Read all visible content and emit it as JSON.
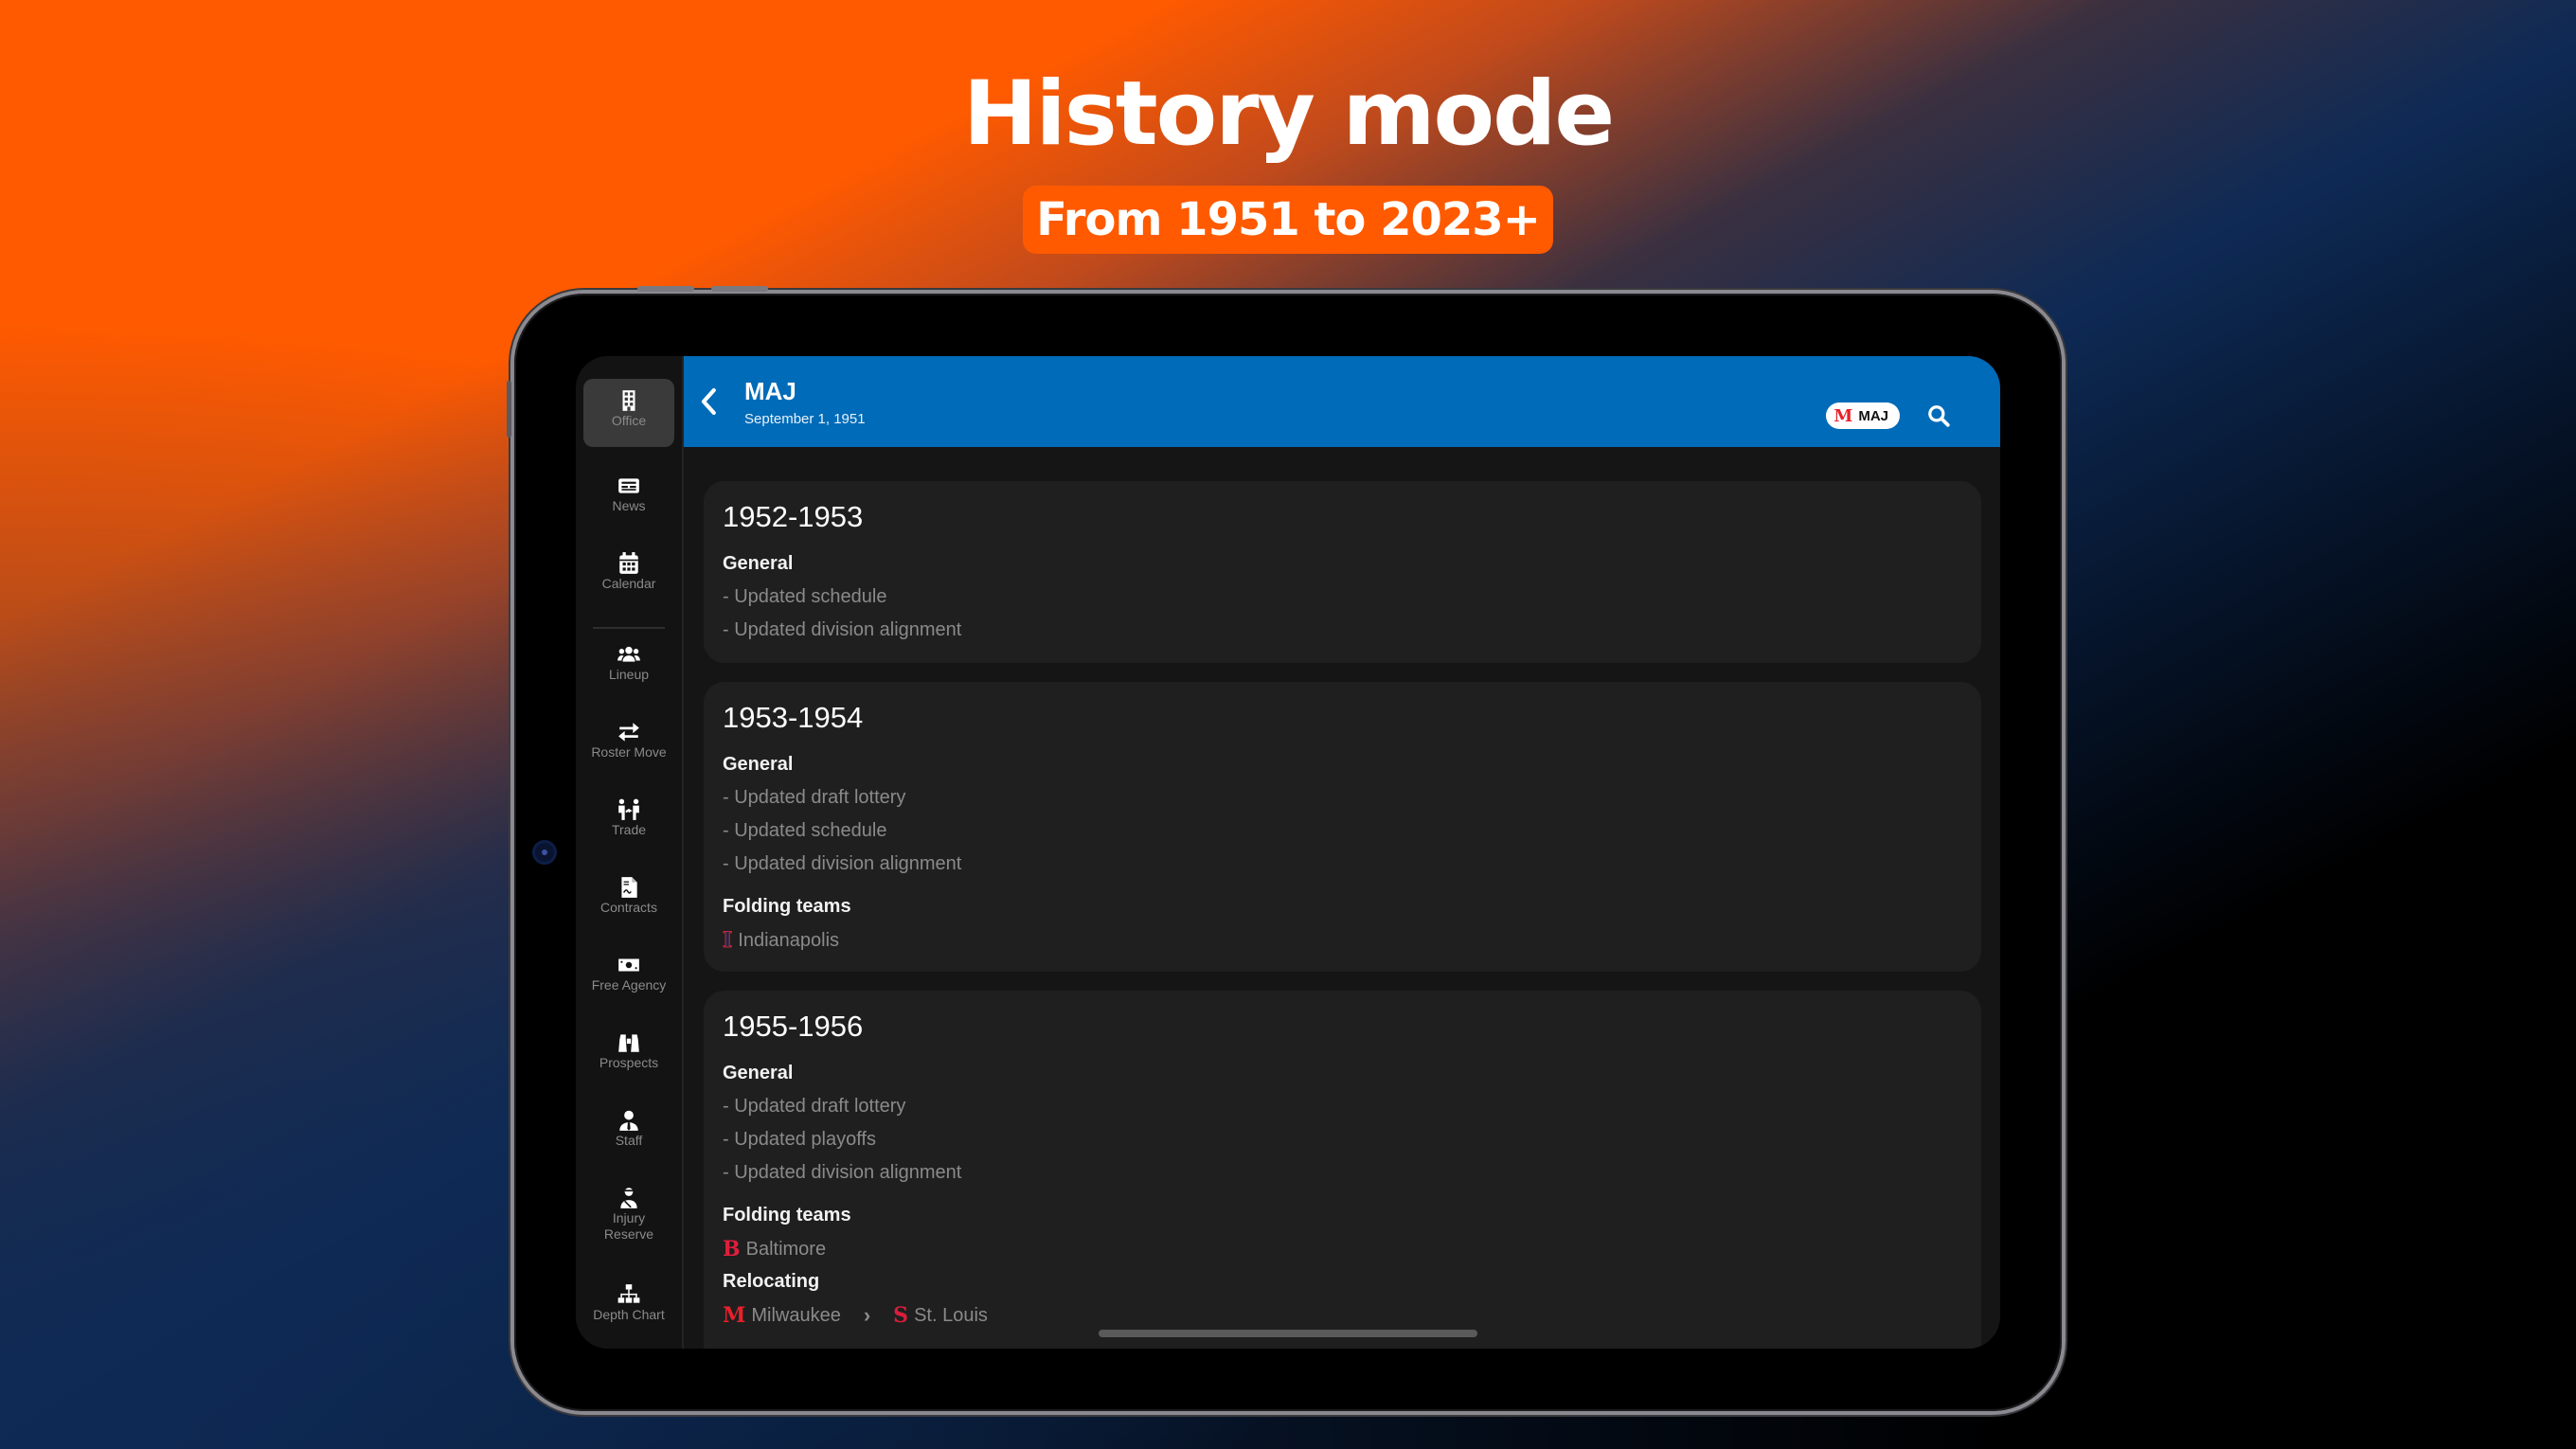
{
  "promo": {
    "headline": "History mode",
    "badge": "From 1951 to 2023+",
    "colors": {
      "orange": "#ff5a00",
      "navy": "#0e2a55"
    }
  },
  "sidebar": {
    "items": [
      {
        "label": "Office",
        "icon": "building-icon",
        "active": true
      },
      {
        "label": "News",
        "icon": "newspaper-icon",
        "active": false
      },
      {
        "label": "Calendar",
        "icon": "calendar-icon",
        "active": false
      },
      {
        "label": "Lineup",
        "icon": "users-icon",
        "active": false
      },
      {
        "label": "Roster Move",
        "icon": "swap-arrows-icon",
        "active": false
      },
      {
        "label": "Trade",
        "icon": "trade-people-icon",
        "active": false
      },
      {
        "label": "Contracts",
        "icon": "contract-document-icon",
        "active": false
      },
      {
        "label": "Free Agency",
        "icon": "money-bill-icon",
        "active": false
      },
      {
        "label": "Prospects",
        "icon": "binoculars-icon",
        "active": false
      },
      {
        "label": "Staff",
        "icon": "staff-person-icon",
        "active": false
      },
      {
        "label": "Injury Reserve",
        "icon": "injured-person-icon",
        "active": false
      },
      {
        "label": "Depth Chart",
        "icon": "hierarchy-icon",
        "active": false
      }
    ]
  },
  "header": {
    "title": "MAJ",
    "subtitle": "September 1, 1951",
    "league_chip": "MAJ",
    "league_logo": "M",
    "accent": "#006bb8"
  },
  "seasons": [
    {
      "title": "1952-1953",
      "general_label": "General",
      "general": [
        "- Updated schedule",
        "- Updated division alignment"
      ]
    },
    {
      "title": "1953-1954",
      "general_label": "General",
      "general": [
        "- Updated draft lottery",
        "- Updated schedule",
        "- Updated division alignment"
      ],
      "folding_label": "Folding teams",
      "folding": [
        {
          "logo": "I",
          "name": "Indianapolis",
          "color": "#1c2b4a",
          "outline": "#d0243a"
        }
      ]
    },
    {
      "title": "1955-1956",
      "general_label": "General",
      "general": [
        "- Updated draft lottery",
        "- Updated playoffs",
        "- Updated division alignment"
      ],
      "folding_label": "Folding teams",
      "folding": [
        {
          "logo": "B",
          "name": "Baltimore",
          "color": "#e01e3c"
        }
      ],
      "relocating_label": "Relocating",
      "relocating": {
        "from": {
          "logo": "M",
          "name": "Milwaukee",
          "color": "#e8202a"
        },
        "arrow": "›",
        "to": {
          "logo": "S",
          "name": "St. Louis",
          "color": "#d81e3c"
        }
      }
    }
  ]
}
